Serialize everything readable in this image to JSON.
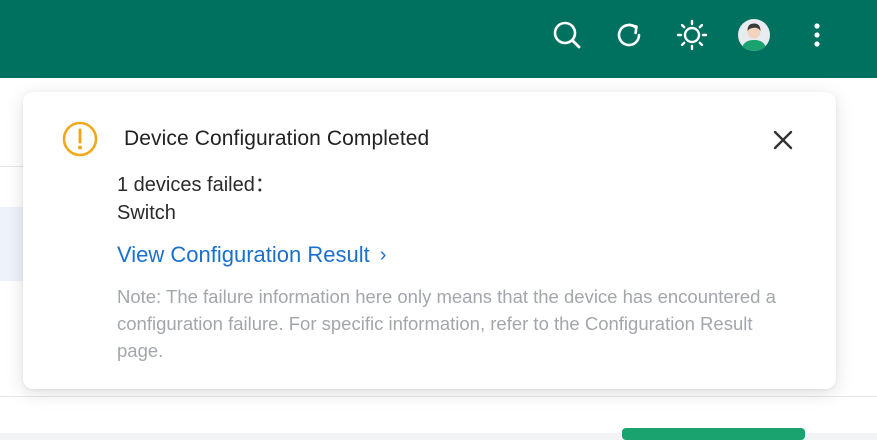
{
  "header": {
    "icons": [
      "search-icon",
      "refresh-icon",
      "brightness-icon",
      "avatar",
      "more-vertical-icon"
    ]
  },
  "notification": {
    "title": "Device Configuration Completed",
    "failed_label": "1 devices failed：",
    "failed_device": "Switch",
    "link_label": "View Configuration Result",
    "link_chevron": "›",
    "note": "Note: The failure information here only means that the device has encountered a configuration failure. For specific information, refer to the Configuration Result page.",
    "status": "warning"
  },
  "colors": {
    "header_bg": "#00705f",
    "warning": "#f2a81d",
    "link": "#1a70cf",
    "note_text": "#a3a6ab"
  }
}
